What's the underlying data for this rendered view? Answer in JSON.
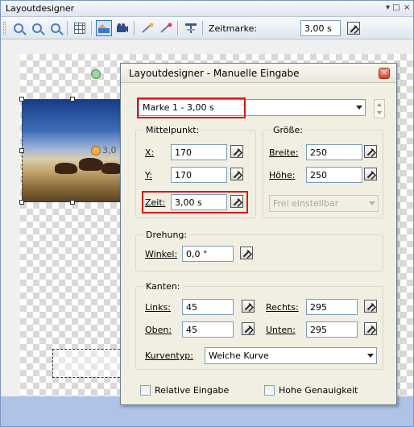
{
  "window": {
    "title": "Layoutdesigner",
    "controls": {
      "pin": "▾ ⊓",
      "close": "×"
    }
  },
  "toolbar": {
    "zeitmarke_label": "Zeitmarke:",
    "zeitmarke_value": "3,00 s",
    "icons": [
      "zoom-in-icon",
      "zoom-out-icon",
      "zoom-fit-icon",
      "grid-icon",
      "layout-mode-icon",
      "camera-icon",
      "keyframe-add-icon",
      "keyframe-remove-icon",
      "align-icon",
      "key-icon"
    ]
  },
  "canvas": {
    "center_label": "3,0"
  },
  "dialog": {
    "title": "Layoutdesigner - Manuelle Eingabe",
    "marker_value": "Marke 1 - 3,00 s",
    "mittelpunkt": {
      "label": "Mittelpunkt:",
      "x_label": "X:",
      "x_value": "170",
      "y_label": "Y:",
      "y_value": "170"
    },
    "groesse": {
      "label": "Größe:",
      "breite_label": "Breite:",
      "breite_value": "250",
      "hoehe_label": "Höhe:",
      "hoehe_value": "250",
      "mode_value": "Frei einstellbar"
    },
    "zeit": {
      "label": "Zeit:",
      "value": "3,00 s"
    },
    "drehung": {
      "label": "Drehung:",
      "winkel_label": "Winkel:",
      "winkel_value": "0,0 °"
    },
    "kanten": {
      "label": "Kanten:",
      "links_label": "Links:",
      "links_value": "45",
      "rechts_label": "Rechts:",
      "rechts_value": "295",
      "oben_label": "Oben:",
      "oben_value": "45",
      "unten_label": "Unten:",
      "unten_value": "295",
      "kurventyp_label": "Kurventyp:",
      "kurventyp_value": "Weiche Kurve"
    },
    "relative_label": "Relative Eingabe",
    "hohe_label": "Hohe Genauigkeit"
  },
  "colors": {
    "highlight_red": "#e0151b",
    "dialog_bg": "#f1efe2",
    "canvas_blue": "#aec3e6"
  }
}
